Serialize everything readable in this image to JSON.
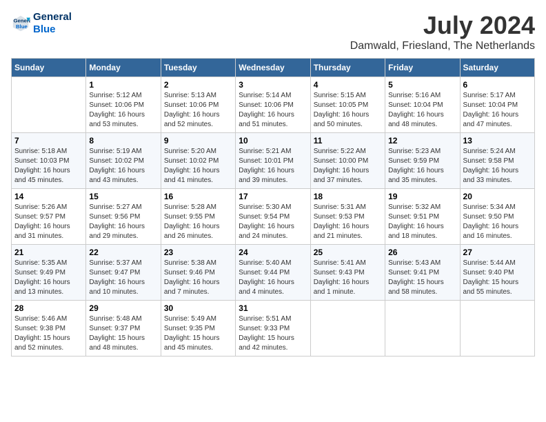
{
  "header": {
    "logo_line1": "General",
    "logo_line2": "Blue",
    "month_year": "July 2024",
    "location": "Damwald, Friesland, The Netherlands"
  },
  "days_of_week": [
    "Sunday",
    "Monday",
    "Tuesday",
    "Wednesday",
    "Thursday",
    "Friday",
    "Saturday"
  ],
  "weeks": [
    [
      {
        "day": "",
        "info": ""
      },
      {
        "day": "1",
        "info": "Sunrise: 5:12 AM\nSunset: 10:06 PM\nDaylight: 16 hours\nand 53 minutes."
      },
      {
        "day": "2",
        "info": "Sunrise: 5:13 AM\nSunset: 10:06 PM\nDaylight: 16 hours\nand 52 minutes."
      },
      {
        "day": "3",
        "info": "Sunrise: 5:14 AM\nSunset: 10:06 PM\nDaylight: 16 hours\nand 51 minutes."
      },
      {
        "day": "4",
        "info": "Sunrise: 5:15 AM\nSunset: 10:05 PM\nDaylight: 16 hours\nand 50 minutes."
      },
      {
        "day": "5",
        "info": "Sunrise: 5:16 AM\nSunset: 10:04 PM\nDaylight: 16 hours\nand 48 minutes."
      },
      {
        "day": "6",
        "info": "Sunrise: 5:17 AM\nSunset: 10:04 PM\nDaylight: 16 hours\nand 47 minutes."
      }
    ],
    [
      {
        "day": "7",
        "info": "Sunrise: 5:18 AM\nSunset: 10:03 PM\nDaylight: 16 hours\nand 45 minutes."
      },
      {
        "day": "8",
        "info": "Sunrise: 5:19 AM\nSunset: 10:02 PM\nDaylight: 16 hours\nand 43 minutes."
      },
      {
        "day": "9",
        "info": "Sunrise: 5:20 AM\nSunset: 10:02 PM\nDaylight: 16 hours\nand 41 minutes."
      },
      {
        "day": "10",
        "info": "Sunrise: 5:21 AM\nSunset: 10:01 PM\nDaylight: 16 hours\nand 39 minutes."
      },
      {
        "day": "11",
        "info": "Sunrise: 5:22 AM\nSunset: 10:00 PM\nDaylight: 16 hours\nand 37 minutes."
      },
      {
        "day": "12",
        "info": "Sunrise: 5:23 AM\nSunset: 9:59 PM\nDaylight: 16 hours\nand 35 minutes."
      },
      {
        "day": "13",
        "info": "Sunrise: 5:24 AM\nSunset: 9:58 PM\nDaylight: 16 hours\nand 33 minutes."
      }
    ],
    [
      {
        "day": "14",
        "info": "Sunrise: 5:26 AM\nSunset: 9:57 PM\nDaylight: 16 hours\nand 31 minutes."
      },
      {
        "day": "15",
        "info": "Sunrise: 5:27 AM\nSunset: 9:56 PM\nDaylight: 16 hours\nand 29 minutes."
      },
      {
        "day": "16",
        "info": "Sunrise: 5:28 AM\nSunset: 9:55 PM\nDaylight: 16 hours\nand 26 minutes."
      },
      {
        "day": "17",
        "info": "Sunrise: 5:30 AM\nSunset: 9:54 PM\nDaylight: 16 hours\nand 24 minutes."
      },
      {
        "day": "18",
        "info": "Sunrise: 5:31 AM\nSunset: 9:53 PM\nDaylight: 16 hours\nand 21 minutes."
      },
      {
        "day": "19",
        "info": "Sunrise: 5:32 AM\nSunset: 9:51 PM\nDaylight: 16 hours\nand 18 minutes."
      },
      {
        "day": "20",
        "info": "Sunrise: 5:34 AM\nSunset: 9:50 PM\nDaylight: 16 hours\nand 16 minutes."
      }
    ],
    [
      {
        "day": "21",
        "info": "Sunrise: 5:35 AM\nSunset: 9:49 PM\nDaylight: 16 hours\nand 13 minutes."
      },
      {
        "day": "22",
        "info": "Sunrise: 5:37 AM\nSunset: 9:47 PM\nDaylight: 16 hours\nand 10 minutes."
      },
      {
        "day": "23",
        "info": "Sunrise: 5:38 AM\nSunset: 9:46 PM\nDaylight: 16 hours\nand 7 minutes."
      },
      {
        "day": "24",
        "info": "Sunrise: 5:40 AM\nSunset: 9:44 PM\nDaylight: 16 hours\nand 4 minutes."
      },
      {
        "day": "25",
        "info": "Sunrise: 5:41 AM\nSunset: 9:43 PM\nDaylight: 16 hours\nand 1 minute."
      },
      {
        "day": "26",
        "info": "Sunrise: 5:43 AM\nSunset: 9:41 PM\nDaylight: 15 hours\nand 58 minutes."
      },
      {
        "day": "27",
        "info": "Sunrise: 5:44 AM\nSunset: 9:40 PM\nDaylight: 15 hours\nand 55 minutes."
      }
    ],
    [
      {
        "day": "28",
        "info": "Sunrise: 5:46 AM\nSunset: 9:38 PM\nDaylight: 15 hours\nand 52 minutes."
      },
      {
        "day": "29",
        "info": "Sunrise: 5:48 AM\nSunset: 9:37 PM\nDaylight: 15 hours\nand 48 minutes."
      },
      {
        "day": "30",
        "info": "Sunrise: 5:49 AM\nSunset: 9:35 PM\nDaylight: 15 hours\nand 45 minutes."
      },
      {
        "day": "31",
        "info": "Sunrise: 5:51 AM\nSunset: 9:33 PM\nDaylight: 15 hours\nand 42 minutes."
      },
      {
        "day": "",
        "info": ""
      },
      {
        "day": "",
        "info": ""
      },
      {
        "day": "",
        "info": ""
      }
    ]
  ]
}
